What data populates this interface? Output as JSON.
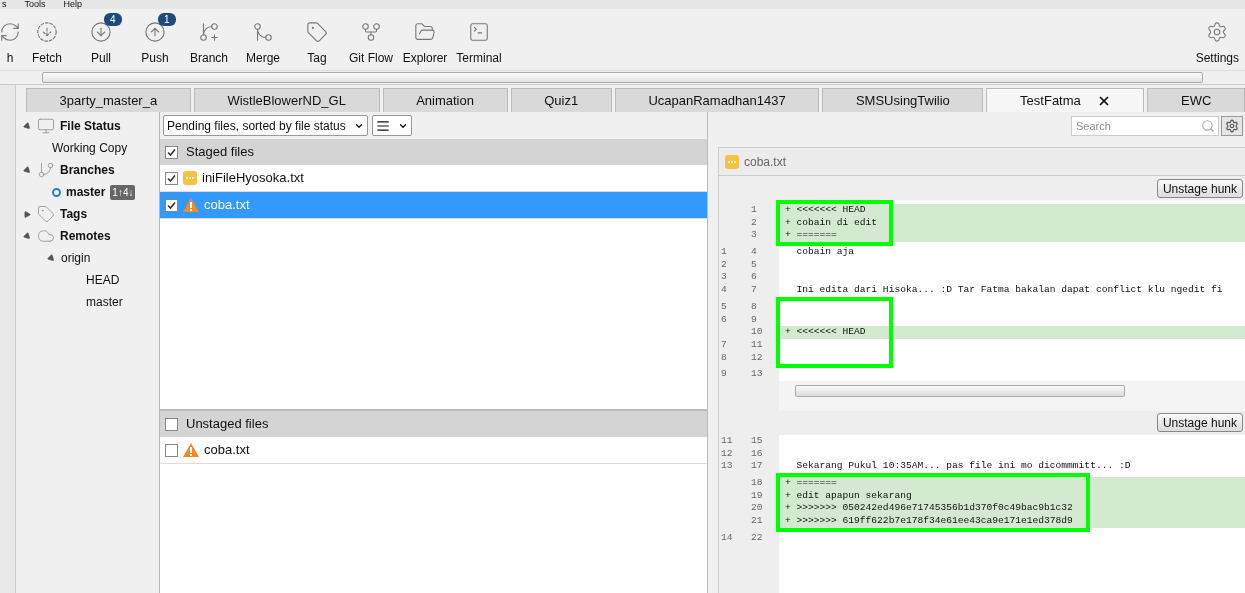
{
  "menu": [
    "s",
    "Tools",
    "Help"
  ],
  "toolbar": [
    {
      "kind": "refresh",
      "label": "h"
    },
    {
      "kind": "fetch",
      "label": "Fetch"
    },
    {
      "kind": "pull",
      "label": "Pull",
      "badge": "4"
    },
    {
      "kind": "push",
      "label": "Push",
      "badge": "1"
    },
    {
      "kind": "branch",
      "label": "Branch"
    },
    {
      "kind": "merge",
      "label": "Merge"
    },
    {
      "kind": "tag",
      "label": "Tag"
    },
    {
      "kind": "flow",
      "label": "Git Flow"
    },
    {
      "kind": "explorer",
      "label": "Explorer"
    },
    {
      "kind": "terminal",
      "label": "Terminal"
    }
  ],
  "settings": {
    "label": "Settings"
  },
  "tabs": [
    {
      "label": "3party_master_a",
      "selected": false
    },
    {
      "label": "WistleBlowerND_GL",
      "selected": false
    },
    {
      "label": "Animation",
      "selected": false
    },
    {
      "label": "Quiz1",
      "selected": false
    },
    {
      "label": "UcapanRamadhan1437",
      "selected": false
    },
    {
      "label": "SMSUsingTwilio",
      "selected": false
    },
    {
      "label": "TestFatma",
      "selected": true
    },
    {
      "label": "EWC",
      "selected": false
    }
  ],
  "search": {
    "placeholder": "Search"
  },
  "sidebar": [
    {
      "kind": "status",
      "label": "File Status",
      "expanded": true,
      "children": [
        {
          "label": "Working Copy"
        }
      ]
    },
    {
      "kind": "branches",
      "label": "Branches",
      "expanded": true,
      "children": [
        {
          "label": "master",
          "current": true,
          "badge": "1↑4↓"
        }
      ]
    },
    {
      "kind": "tags",
      "label": "Tags",
      "expanded": false
    },
    {
      "kind": "remotes",
      "label": "Remotes",
      "expanded": true,
      "children": [
        {
          "label": "origin",
          "expanded": true,
          "children": [
            {
              "label": "HEAD"
            },
            {
              "label": "master"
            }
          ]
        }
      ]
    }
  ],
  "view_select": "Pending files, sorted by file status",
  "staged": {
    "label": "Staged files",
    "checked": true,
    "files": [
      {
        "name": "iniFileHyosoka.txt",
        "kind": "modified",
        "checked": true,
        "selected": false
      },
      {
        "name": "coba.txt",
        "kind": "conflict",
        "checked": true,
        "selected": true
      }
    ]
  },
  "unstaged": {
    "label": "Unstaged files",
    "checked": false,
    "files": [
      {
        "name": "coba.txt",
        "kind": "conflict",
        "checked": false,
        "selected": false
      }
    ]
  },
  "diff": {
    "file": "coba.txt",
    "kind": "modified",
    "hunks": [
      {
        "button": "Unstage hunk",
        "blocks": [
          {
            "boxed": true,
            "lines": [
              {
                "kind": "added",
                "new": "1",
                "text": "+ <<<<<<< HEAD"
              },
              {
                "kind": "added",
                "new": "2",
                "text": "+ cobain di edit"
              },
              {
                "kind": "added",
                "new": "3",
                "text": "+ ======="
              }
            ]
          },
          {
            "boxed": false,
            "lines": [
              {
                "kind": "context",
                "old": "1",
                "new": "4",
                "text": "  cobain aja"
              },
              {
                "kind": "context",
                "old": "2",
                "new": "5"
              },
              {
                "kind": "context",
                "old": "3",
                "new": "6"
              },
              {
                "kind": "context",
                "old": "4",
                "new": "7",
                "text": "  Ini edita dari Hisoka... :D Tar Fatma bakalan dapat conflict klu ngedit fi"
              }
            ]
          },
          {
            "boxed": true,
            "lines": [
              {
                "kind": "context",
                "old": "5",
                "new": "8"
              },
              {
                "kind": "context",
                "old": "6",
                "new": "9"
              },
              {
                "kind": "added",
                "new": "10",
                "text": "+ <<<<<<< HEAD"
              },
              {
                "kind": "context",
                "old": "7",
                "new": "11"
              },
              {
                "kind": "context",
                "old": "8",
                "new": "12"
              }
            ]
          },
          {
            "boxed": false,
            "lines": [
              {
                "kind": "context",
                "old": "9",
                "new": "13"
              }
            ]
          }
        ]
      },
      {
        "button": "Unstage hunk",
        "blocks": [
          {
            "boxed": false,
            "lines": [
              {
                "kind": "context",
                "old": "11",
                "new": "15"
              },
              {
                "kind": "context",
                "old": "12",
                "new": "16"
              },
              {
                "kind": "context",
                "old": "13",
                "new": "17",
                "text": "  Sekarang Pukul 10:35AM... pas file ini mo dicommmitt... :D"
              }
            ]
          },
          {
            "boxed": true,
            "lines": [
              {
                "kind": "added",
                "new": "18",
                "text": "+ ======="
              },
              {
                "kind": "added",
                "new": "19",
                "text": "+ edit apapun sekarang"
              },
              {
                "kind": "added",
                "new": "20",
                "text": "+ >>>>>>> 050242ed496e71745356b1d370f0c49bac9b1c32"
              },
              {
                "kind": "added",
                "new": "21",
                "text": "+ >>>>>>> 619ff622b7e178f34e61ee43ca9e171e1ed378d9"
              }
            ]
          },
          {
            "boxed": false,
            "lines": [
              {
                "kind": "context",
                "old": "14",
                "new": "22"
              }
            ]
          }
        ]
      }
    ]
  }
}
